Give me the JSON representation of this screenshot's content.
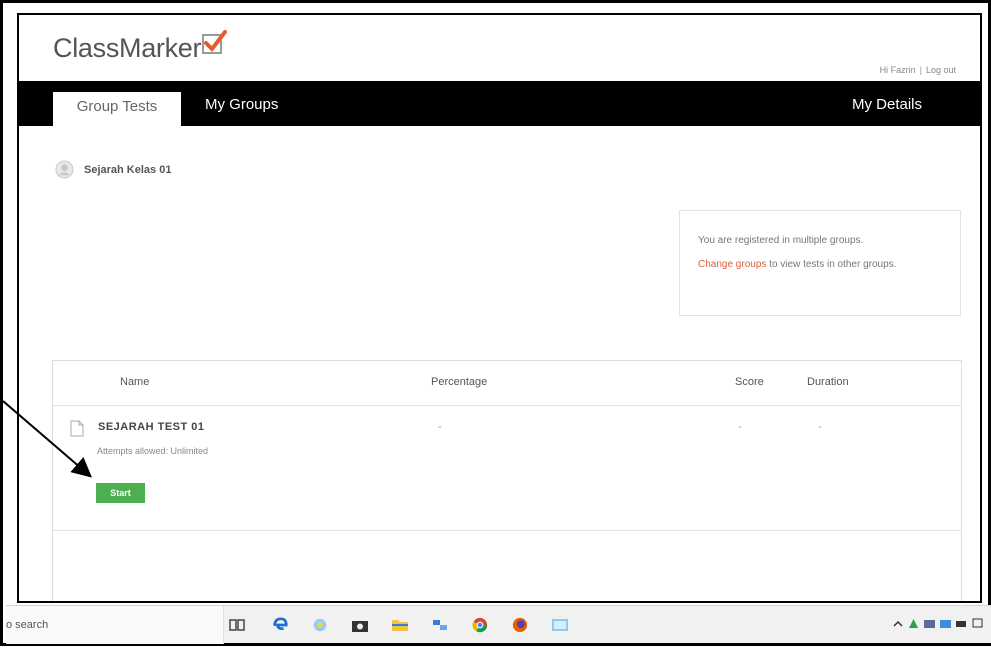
{
  "app": {
    "logo_text": "ClassMarker",
    "greeting": "Hi Fazrin",
    "separator": "|",
    "logout": "Log out"
  },
  "nav": {
    "tabs": [
      "Group Tests",
      "My Groups"
    ],
    "right": "My Details"
  },
  "group": {
    "name": "Sejarah Kelas 01"
  },
  "notice": {
    "line1": "You are registered in multiple groups.",
    "link": "Change groups",
    "line2_rest": " to view tests in other groups."
  },
  "table": {
    "headers": [
      "Name",
      "Percentage",
      "Score",
      "Duration"
    ],
    "rows": [
      {
        "title": "SEJARAH TEST 01",
        "attempts": "Attempts allowed: Unlimited",
        "button": "Start",
        "percentage": "-",
        "score": "-",
        "duration": "-"
      }
    ]
  },
  "taskbar": {
    "search_text": "o search"
  },
  "colors": {
    "accent_red": "#d9623b",
    "start_green": "#4caf50",
    "nav_black": "#000000"
  },
  "icons": [
    "logo-checkmark-icon",
    "group-user-icon",
    "document-icon",
    "task-view-icon",
    "edge-icon",
    "chrome-icon",
    "firefox-icon",
    "camera-icon",
    "folder-icon",
    "arrow-annotation"
  ]
}
